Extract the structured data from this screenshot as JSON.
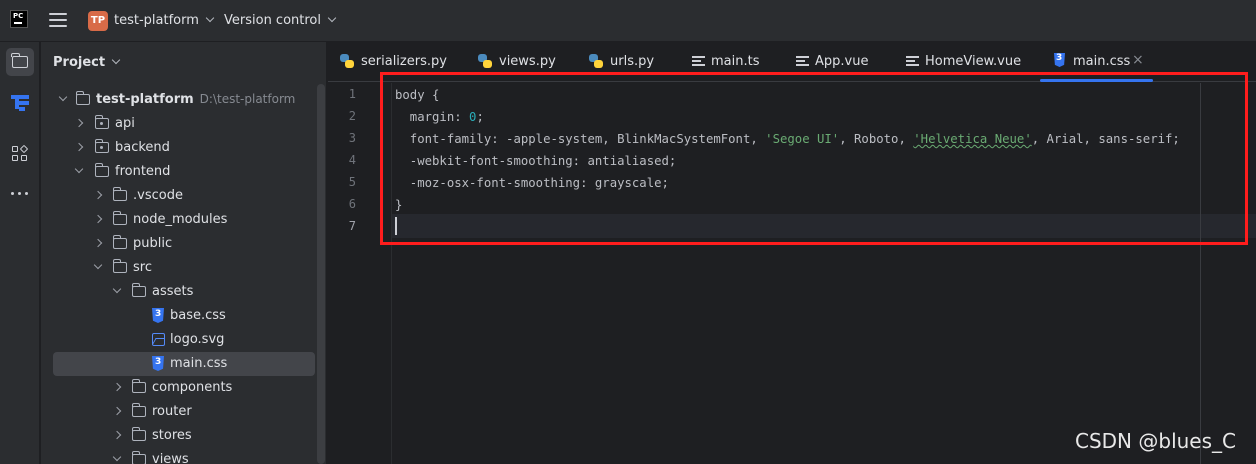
{
  "titlebar": {
    "project_badge": "TP",
    "project_name": "test-platform",
    "vcs_label": "Version control"
  },
  "project_panel": {
    "title": "Project",
    "tree": [
      {
        "label": "test-platform",
        "path": "D:\\test-platform"
      },
      {
        "label": "api"
      },
      {
        "label": "backend"
      },
      {
        "label": "frontend"
      },
      {
        "label": ".vscode"
      },
      {
        "label": "node_modules"
      },
      {
        "label": "public"
      },
      {
        "label": "src"
      },
      {
        "label": "assets"
      },
      {
        "label": "base.css"
      },
      {
        "label": "logo.svg"
      },
      {
        "label": "main.css"
      },
      {
        "label": "components"
      },
      {
        "label": "router"
      },
      {
        "label": "stores"
      },
      {
        "label": "views"
      }
    ]
  },
  "tabs": [
    {
      "label": "serializers.py",
      "icon": "python-icon"
    },
    {
      "label": "views.py",
      "icon": "python-icon"
    },
    {
      "label": "urls.py",
      "icon": "python-icon"
    },
    {
      "label": "main.ts",
      "icon": "text-file-icon"
    },
    {
      "label": "App.vue",
      "icon": "text-file-icon"
    },
    {
      "label": "HomeView.vue",
      "icon": "text-file-icon"
    },
    {
      "label": "main.css",
      "icon": "css-icon",
      "active": true
    }
  ],
  "editor": {
    "line_numbers": [
      "1",
      "2",
      "3",
      "4",
      "5",
      "6",
      "7"
    ],
    "code": {
      "l1": "body {",
      "l2_prop": "  margin: ",
      "l2_val": "0",
      "l2_end": ";",
      "l3_a": "  font-family: -apple-system, BlinkMacSystemFont, ",
      "l3_s1": "'Segoe UI'",
      "l3_b": ", Roboto, ",
      "l3_s2": "'Helvetica Neue'",
      "l3_c": ", Arial, sans-serif;",
      "l4": "  -webkit-font-smoothing: antialiased;",
      "l5": "  -moz-osx-font-smoothing: grayscale;",
      "l6": "}"
    }
  },
  "watermark": "CSDN @blues_C",
  "colors": {
    "accent": "#3574f0",
    "highlight_box": "#ff1d1d",
    "string": "#6aab73",
    "number": "#2aacb8"
  }
}
